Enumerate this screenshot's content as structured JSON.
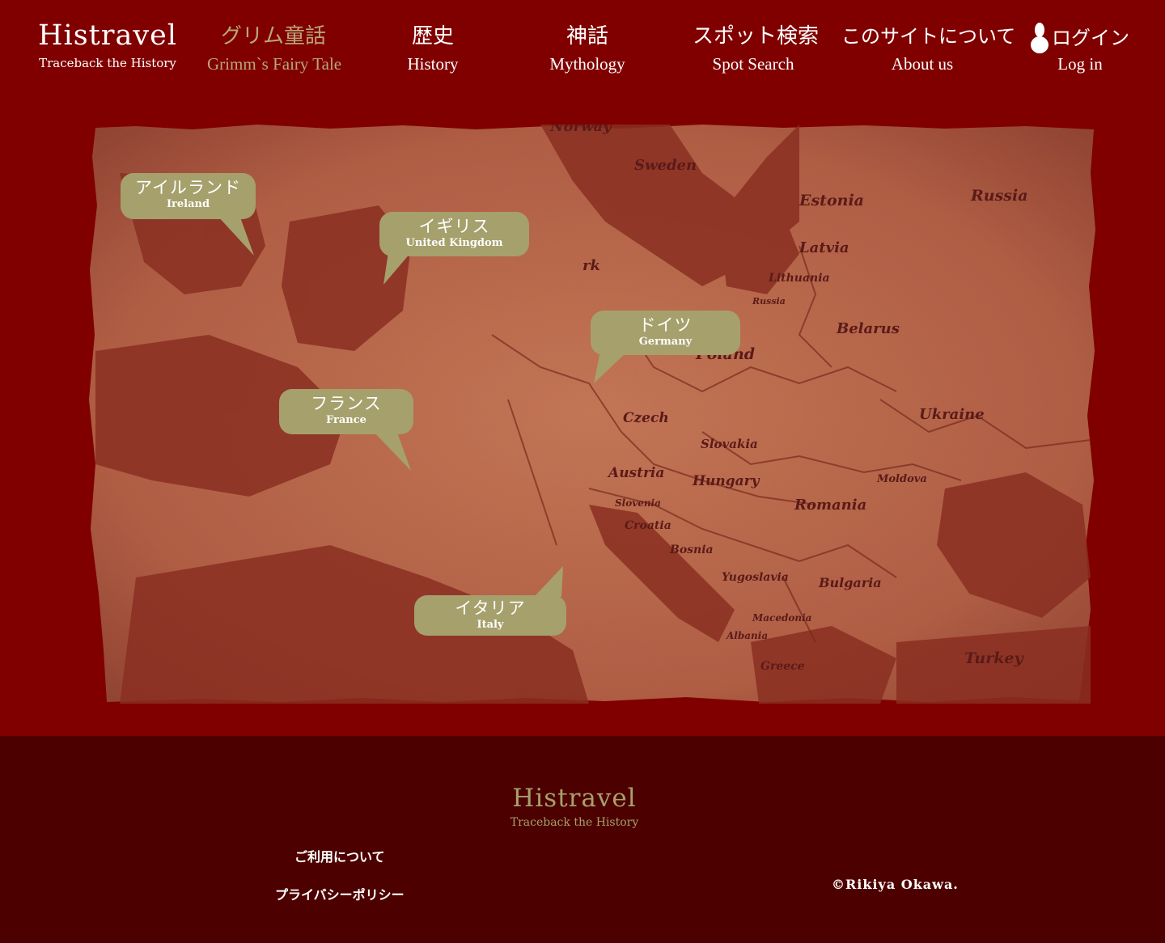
{
  "header": {
    "logo": {
      "title": "Histravel",
      "subtitle": "Traceback the History"
    },
    "nav": [
      {
        "jp": "グリム童話",
        "en": "Grimm`s Fairy Tale",
        "active": true
      },
      {
        "jp": "歴史",
        "en": "History"
      },
      {
        "jp": "神話",
        "en": "Mythology"
      },
      {
        "jp": "スポット検索",
        "en": "Spot Search"
      },
      {
        "jp": "このサイトについて",
        "en": "About us"
      },
      {
        "jp": "ログイン",
        "en": "Log in",
        "icon": "user-icon"
      }
    ]
  },
  "map": {
    "countries": [
      {
        "jp": "アイルランド",
        "en": "Ireland"
      },
      {
        "jp": "イギリス",
        "en": "United Kingdom"
      },
      {
        "jp": "ドイツ",
        "en": "Germany"
      },
      {
        "jp": "フランス",
        "en": "France"
      },
      {
        "jp": "イタリア",
        "en": "Italy"
      }
    ],
    "labels": [
      "Norway",
      "Sweden",
      "Estonia",
      "Russia",
      "Latvia",
      "Lithuania",
      "Russia",
      "Belarus",
      "Poland",
      "Czech",
      "Ukraine",
      "Slovakia",
      "Austria",
      "Hungary",
      "Moldova",
      "Slovenia",
      "Romania",
      "Croatia",
      "Bosnia",
      "Yugoslavia",
      "Bulgaria",
      "Macedonia",
      "Albania",
      "Greece",
      "Turkey",
      "rk"
    ]
  },
  "footer": {
    "logo": {
      "title": "Histravel",
      "subtitle": "Traceback the History"
    },
    "links": [
      "ご利用について",
      "プライバシーポリシー"
    ],
    "copyright": "©Rikiya Okawa."
  },
  "colors": {
    "background": "#800000",
    "footer_background": "#4d0000",
    "accent": "#a6a06c",
    "active_nav": "#b8a77a",
    "map_land_dark": "#8a2f22",
    "map_land_light": "#c1704f"
  }
}
